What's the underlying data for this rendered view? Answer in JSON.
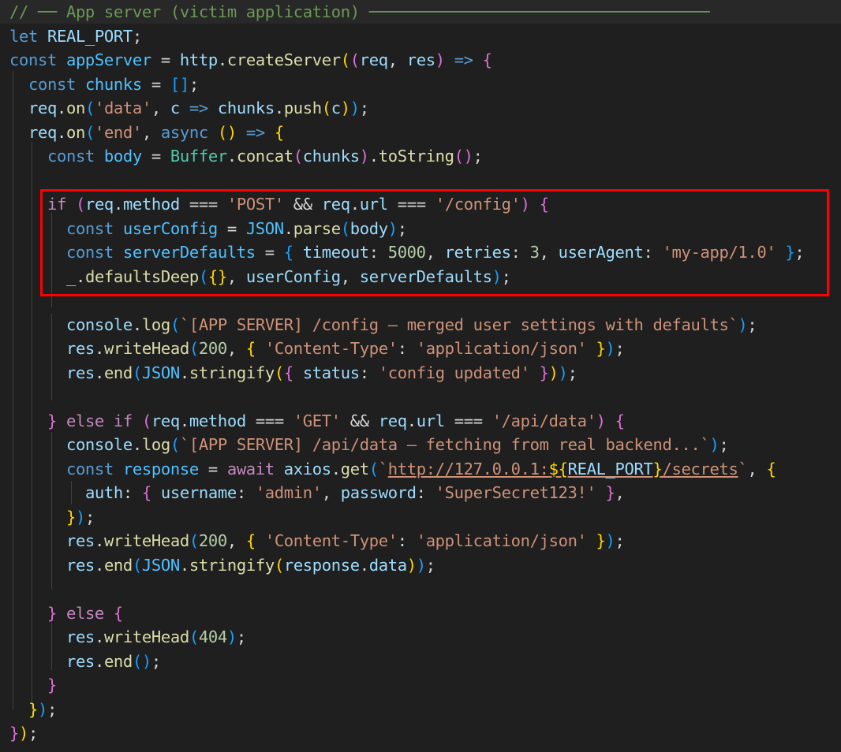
{
  "editor": {
    "highlighted_range": "lines 9-12",
    "lines": [
      [
        [
          "// ── App server (victim application) ────────────────────────────────────",
          "cm"
        ]
      ],
      [
        [
          "let ",
          "k"
        ],
        [
          "REAL_PORT",
          "v"
        ],
        [
          ";",
          "o"
        ]
      ],
      [
        [
          "const ",
          "k"
        ],
        [
          "appServer",
          "cst"
        ],
        [
          " = ",
          "o"
        ],
        [
          "http",
          "v"
        ],
        [
          ".",
          "o"
        ],
        [
          "createServer",
          "f"
        ],
        [
          "(",
          "b1"
        ],
        [
          "(",
          "b2"
        ],
        [
          "req",
          "v"
        ],
        [
          ", ",
          "o"
        ],
        [
          "res",
          "v"
        ],
        [
          ")",
          "b2"
        ],
        [
          " => ",
          "k"
        ],
        [
          "{",
          "b2"
        ]
      ],
      [
        [
          "  ",
          "o"
        ],
        [
          "const ",
          "k"
        ],
        [
          "chunks",
          "cst"
        ],
        [
          " = ",
          "o"
        ],
        [
          "[]",
          "b3"
        ],
        [
          ";",
          "o"
        ]
      ],
      [
        [
          "  ",
          "o"
        ],
        [
          "req",
          "v"
        ],
        [
          ".",
          "o"
        ],
        [
          "on",
          "f"
        ],
        [
          "(",
          "b3"
        ],
        [
          "'data'",
          "s"
        ],
        [
          ", ",
          "o"
        ],
        [
          "c",
          "v"
        ],
        [
          " => ",
          "k"
        ],
        [
          "chunks",
          "v"
        ],
        [
          ".",
          "o"
        ],
        [
          "push",
          "f"
        ],
        [
          "(",
          "b1"
        ],
        [
          "c",
          "v"
        ],
        [
          ")",
          "b1"
        ],
        [
          ")",
          "b3"
        ],
        [
          ";",
          "o"
        ]
      ],
      [
        [
          "  ",
          "o"
        ],
        [
          "req",
          "v"
        ],
        [
          ".",
          "o"
        ],
        [
          "on",
          "f"
        ],
        [
          "(",
          "b3"
        ],
        [
          "'end'",
          "s"
        ],
        [
          ", ",
          "o"
        ],
        [
          "async ",
          "k"
        ],
        [
          "()",
          "b1"
        ],
        [
          " => ",
          "k"
        ],
        [
          "{",
          "b1"
        ]
      ],
      [
        [
          "    ",
          "o"
        ],
        [
          "const ",
          "k"
        ],
        [
          "body",
          "cst"
        ],
        [
          " = ",
          "o"
        ],
        [
          "Buffer",
          "t"
        ],
        [
          ".",
          "o"
        ],
        [
          "concat",
          "f"
        ],
        [
          "(",
          "b2"
        ],
        [
          "chunks",
          "v"
        ],
        [
          ")",
          "b2"
        ],
        [
          ".",
          "o"
        ],
        [
          "toString",
          "f"
        ],
        [
          "()",
          "b2"
        ],
        [
          ";",
          "o"
        ]
      ],
      [],
      [
        [
          "    ",
          "o"
        ],
        [
          "if ",
          "c"
        ],
        [
          "(",
          "b2"
        ],
        [
          "req",
          "v"
        ],
        [
          ".",
          "o"
        ],
        [
          "method",
          "v"
        ],
        [
          " === ",
          "o"
        ],
        [
          "'POST'",
          "s"
        ],
        [
          " && ",
          "o"
        ],
        [
          "req",
          "v"
        ],
        [
          ".",
          "o"
        ],
        [
          "url",
          "v"
        ],
        [
          " === ",
          "o"
        ],
        [
          "'/config'",
          "s"
        ],
        [
          ")",
          "b2"
        ],
        [
          " ",
          "o"
        ],
        [
          "{",
          "b2"
        ]
      ],
      [
        [
          "      ",
          "o"
        ],
        [
          "const ",
          "k"
        ],
        [
          "userConfig",
          "cst"
        ],
        [
          " = ",
          "o"
        ],
        [
          "JSON",
          "cst"
        ],
        [
          ".",
          "o"
        ],
        [
          "parse",
          "f"
        ],
        [
          "(",
          "b3"
        ],
        [
          "body",
          "v"
        ],
        [
          ")",
          "b3"
        ],
        [
          ";",
          "o"
        ]
      ],
      [
        [
          "      ",
          "o"
        ],
        [
          "const ",
          "k"
        ],
        [
          "serverDefaults",
          "cst"
        ],
        [
          " = ",
          "o"
        ],
        [
          "{ ",
          "b3"
        ],
        [
          "timeout",
          "v"
        ],
        [
          ": ",
          "o"
        ],
        [
          "5000",
          "n"
        ],
        [
          ", ",
          "o"
        ],
        [
          "retries",
          "v"
        ],
        [
          ": ",
          "o"
        ],
        [
          "3",
          "n"
        ],
        [
          ", ",
          "o"
        ],
        [
          "userAgent",
          "v"
        ],
        [
          ": ",
          "o"
        ],
        [
          "'my-app/1.0'",
          "s"
        ],
        [
          " }",
          "b3"
        ],
        [
          ";",
          "o"
        ]
      ],
      [
        [
          "      ",
          "o"
        ],
        [
          "_",
          "v"
        ],
        [
          ".",
          "o"
        ],
        [
          "defaultsDeep",
          "f"
        ],
        [
          "(",
          "b3"
        ],
        [
          "{}",
          "b1"
        ],
        [
          ", ",
          "o"
        ],
        [
          "userConfig",
          "v"
        ],
        [
          ", ",
          "o"
        ],
        [
          "serverDefaults",
          "v"
        ],
        [
          ")",
          "b3"
        ],
        [
          ";",
          "o"
        ]
      ],
      [],
      [
        [
          "      ",
          "o"
        ],
        [
          "console",
          "v"
        ],
        [
          ".",
          "o"
        ],
        [
          "log",
          "f"
        ],
        [
          "(",
          "b3"
        ],
        [
          "`[APP SERVER] /config — merged user settings with defaults`",
          "s"
        ],
        [
          ")",
          "b3"
        ],
        [
          ";",
          "o"
        ]
      ],
      [
        [
          "      ",
          "o"
        ],
        [
          "res",
          "v"
        ],
        [
          ".",
          "o"
        ],
        [
          "writeHead",
          "f"
        ],
        [
          "(",
          "b3"
        ],
        [
          "200",
          "n"
        ],
        [
          ", ",
          "o"
        ],
        [
          "{ ",
          "b1"
        ],
        [
          "'Content-Type'",
          "s"
        ],
        [
          ": ",
          "o"
        ],
        [
          "'application/json'",
          "s"
        ],
        [
          " }",
          "b1"
        ],
        [
          ")",
          "b3"
        ],
        [
          ";",
          "o"
        ]
      ],
      [
        [
          "      ",
          "o"
        ],
        [
          "res",
          "v"
        ],
        [
          ".",
          "o"
        ],
        [
          "end",
          "f"
        ],
        [
          "(",
          "b3"
        ],
        [
          "JSON",
          "cst"
        ],
        [
          ".",
          "o"
        ],
        [
          "stringify",
          "f"
        ],
        [
          "(",
          "b1"
        ],
        [
          "{ ",
          "b2"
        ],
        [
          "status",
          "v"
        ],
        [
          ": ",
          "o"
        ],
        [
          "'config updated'",
          "s"
        ],
        [
          " }",
          "b2"
        ],
        [
          ")",
          "b1"
        ],
        [
          ")",
          "b3"
        ],
        [
          ";",
          "o"
        ]
      ],
      [],
      [
        [
          "    ",
          "o"
        ],
        [
          "}",
          "b2"
        ],
        [
          " else if ",
          "c"
        ],
        [
          "(",
          "b2"
        ],
        [
          "req",
          "v"
        ],
        [
          ".",
          "o"
        ],
        [
          "method",
          "v"
        ],
        [
          " === ",
          "o"
        ],
        [
          "'GET'",
          "s"
        ],
        [
          " && ",
          "o"
        ],
        [
          "req",
          "v"
        ],
        [
          ".",
          "o"
        ],
        [
          "url",
          "v"
        ],
        [
          " === ",
          "o"
        ],
        [
          "'/api/data'",
          "s"
        ],
        [
          ")",
          "b2"
        ],
        [
          " ",
          "o"
        ],
        [
          "{",
          "b2"
        ]
      ],
      [
        [
          "      ",
          "o"
        ],
        [
          "console",
          "v"
        ],
        [
          ".",
          "o"
        ],
        [
          "log",
          "f"
        ],
        [
          "(",
          "b3"
        ],
        [
          "`[APP SERVER] /api/data — fetching from real backend...`",
          "s"
        ],
        [
          ")",
          "b3"
        ],
        [
          ";",
          "o"
        ]
      ],
      [
        [
          "      ",
          "o"
        ],
        [
          "const ",
          "k"
        ],
        [
          "response",
          "cst"
        ],
        [
          " = ",
          "o"
        ],
        [
          "await ",
          "c"
        ],
        [
          "axios",
          "v"
        ],
        [
          ".",
          "o"
        ],
        [
          "get",
          "f"
        ],
        [
          "(",
          "b3"
        ],
        [
          "`",
          "s"
        ],
        [
          "http://127.0.0.1:",
          "s u"
        ],
        [
          "${",
          "b1 u"
        ],
        [
          "REAL_PORT",
          "v u"
        ],
        [
          "}",
          "b1 u"
        ],
        [
          "/secrets",
          "s u"
        ],
        [
          "`",
          "s"
        ],
        [
          ", ",
          "o"
        ],
        [
          "{",
          "b1"
        ]
      ],
      [
        [
          "        ",
          "o"
        ],
        [
          "auth",
          "v"
        ],
        [
          ": ",
          "o"
        ],
        [
          "{ ",
          "b2"
        ],
        [
          "username",
          "v"
        ],
        [
          ": ",
          "o"
        ],
        [
          "'admin'",
          "s"
        ],
        [
          ", ",
          "o"
        ],
        [
          "password",
          "v"
        ],
        [
          ": ",
          "o"
        ],
        [
          "'SuperSecret123!'",
          "s"
        ],
        [
          " }",
          "b2"
        ],
        [
          ",",
          "o"
        ]
      ],
      [
        [
          "      ",
          "o"
        ],
        [
          "}",
          "b1"
        ],
        [
          ")",
          "b3"
        ],
        [
          ";",
          "o"
        ]
      ],
      [
        [
          "      ",
          "o"
        ],
        [
          "res",
          "v"
        ],
        [
          ".",
          "o"
        ],
        [
          "writeHead",
          "f"
        ],
        [
          "(",
          "b3"
        ],
        [
          "200",
          "n"
        ],
        [
          ", ",
          "o"
        ],
        [
          "{ ",
          "b1"
        ],
        [
          "'Content-Type'",
          "s"
        ],
        [
          ": ",
          "o"
        ],
        [
          "'application/json'",
          "s"
        ],
        [
          " }",
          "b1"
        ],
        [
          ")",
          "b3"
        ],
        [
          ";",
          "o"
        ]
      ],
      [
        [
          "      ",
          "o"
        ],
        [
          "res",
          "v"
        ],
        [
          ".",
          "o"
        ],
        [
          "end",
          "f"
        ],
        [
          "(",
          "b3"
        ],
        [
          "JSON",
          "cst"
        ],
        [
          ".",
          "o"
        ],
        [
          "stringify",
          "f"
        ],
        [
          "(",
          "b1"
        ],
        [
          "response",
          "v"
        ],
        [
          ".",
          "o"
        ],
        [
          "data",
          "v"
        ],
        [
          ")",
          "b1"
        ],
        [
          ")",
          "b3"
        ],
        [
          ";",
          "o"
        ]
      ],
      [],
      [
        [
          "    ",
          "o"
        ],
        [
          "}",
          "b2"
        ],
        [
          " else ",
          "c"
        ],
        [
          "{",
          "b2"
        ]
      ],
      [
        [
          "      ",
          "o"
        ],
        [
          "res",
          "v"
        ],
        [
          ".",
          "o"
        ],
        [
          "writeHead",
          "f"
        ],
        [
          "(",
          "b3"
        ],
        [
          "404",
          "n"
        ],
        [
          ")",
          "b3"
        ],
        [
          ";",
          "o"
        ]
      ],
      [
        [
          "      ",
          "o"
        ],
        [
          "res",
          "v"
        ],
        [
          ".",
          "o"
        ],
        [
          "end",
          "f"
        ],
        [
          "()",
          "b3"
        ],
        [
          ";",
          "o"
        ]
      ],
      [
        [
          "    ",
          "o"
        ],
        [
          "}",
          "b2"
        ]
      ],
      [
        [
          "  ",
          "o"
        ],
        [
          "}",
          "b1"
        ],
        [
          ")",
          "b3"
        ],
        [
          ";",
          "o"
        ]
      ],
      [
        [
          "}",
          "b2"
        ],
        [
          ")",
          "b1"
        ],
        [
          ";",
          "o"
        ]
      ]
    ]
  }
}
